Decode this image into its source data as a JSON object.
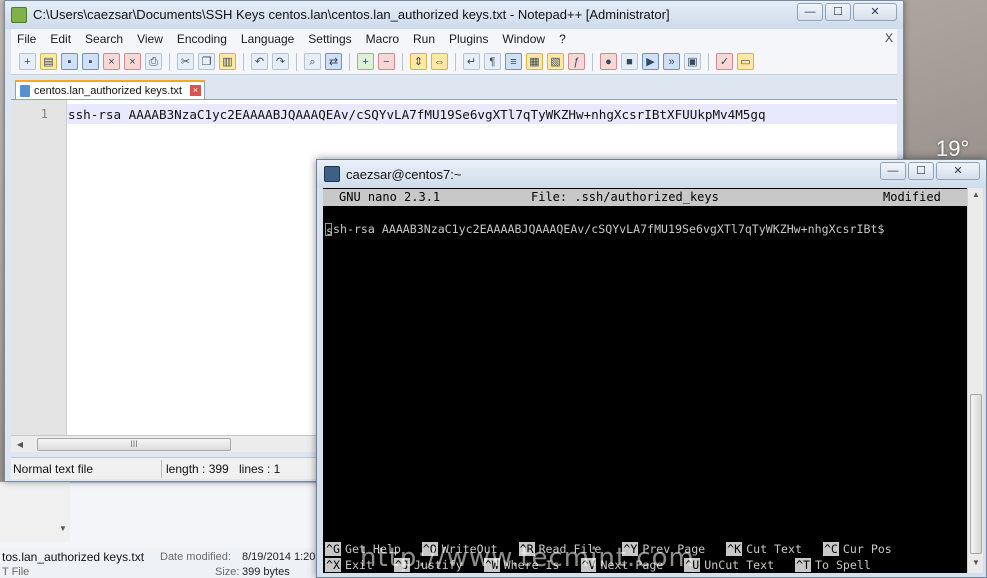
{
  "desktop": {
    "weather_temp": "19°",
    "explorer": {
      "file_name": "tos.lan_authorized keys.txt",
      "date_modified_label": "Date modified:",
      "date_modified_value": "8/19/2014 1:20",
      "type": "T File",
      "size_label": "Size:",
      "size_value": "399 bytes"
    },
    "watermark": "http://www.tecmint.com"
  },
  "notepadpp": {
    "title": "C:\\Users\\caezsar\\Documents\\SSH Keys centos.lan\\centos.lan_authorized keys.txt - Notepad++ [Administrator]",
    "menu": [
      "File",
      "Edit",
      "Search",
      "View",
      "Encoding",
      "Language",
      "Settings",
      "Macro",
      "Run",
      "Plugins",
      "Window",
      "?"
    ],
    "menu_close": "X",
    "toolbar_icons": [
      "new-file-icon",
      "open-file-icon",
      "save-icon",
      "save-all-icon",
      "close-icon",
      "close-all-icon",
      "print-icon",
      "cut-icon",
      "copy-icon",
      "paste-icon",
      "undo-icon",
      "redo-icon",
      "find-icon",
      "replace-icon",
      "zoom-in-icon",
      "zoom-out-icon",
      "sync-v-icon",
      "sync-h-icon",
      "wrap-icon",
      "show-all-icon",
      "indent-guide-icon",
      "udl-icon",
      "doc-map-icon",
      "function-list-icon",
      "record-macro-icon",
      "stop-macro-icon",
      "play-macro-icon",
      "run-multiple-icon",
      "save-macro-icon",
      "spellcheck-icon",
      "folder-icon"
    ],
    "tab": {
      "label": "centos.lan_authorized keys.txt"
    },
    "line_number": "1",
    "line_text_kw": "ssh-rsa",
    "line_text_rest": " AAAAB3NzaC1yc2EAAAABJQAAAQEAv/cSQYvLA7fMU19Se6vgXTl7qTyWKZHw+nhgXcsrIBtXFUUkpMv4M5gq",
    "status": {
      "type": "Normal text file",
      "length": "length : 399",
      "lines": "lines : 1"
    },
    "scroll_grip": "III"
  },
  "putty": {
    "title": "caezsar@centos7:~",
    "nano": {
      "version": "GNU nano 2.3.1",
      "file": "File: .ssh/authorized_keys",
      "state": "Modified",
      "line": "sh-rsa AAAAB3NzaC1yc2EAAAABJQAAAQEAv/cSQYvLA7fMU19Se6vgXTl7qTyWKZHw+nhgXcsrIBt$",
      "line_first_char": "s",
      "shortcuts_row1": [
        {
          "key": "^G",
          "label": "Get Help"
        },
        {
          "key": "^O",
          "label": "WriteOut"
        },
        {
          "key": "^R",
          "label": "Read File"
        },
        {
          "key": "^Y",
          "label": "Prev Page"
        },
        {
          "key": "^K",
          "label": "Cut Text"
        },
        {
          "key": "^C",
          "label": "Cur Pos"
        }
      ],
      "shortcuts_row2": [
        {
          "key": "^X",
          "label": "Exit"
        },
        {
          "key": "^J",
          "label": "Justify"
        },
        {
          "key": "^W",
          "label": "Where Is"
        },
        {
          "key": "^V",
          "label": "Next Page"
        },
        {
          "key": "^U",
          "label": "UnCut Text"
        },
        {
          "key": "^T",
          "label": "To Spell"
        }
      ]
    }
  },
  "window_buttons": {
    "minimize": "—",
    "maximize": "☐",
    "close": "✕"
  }
}
